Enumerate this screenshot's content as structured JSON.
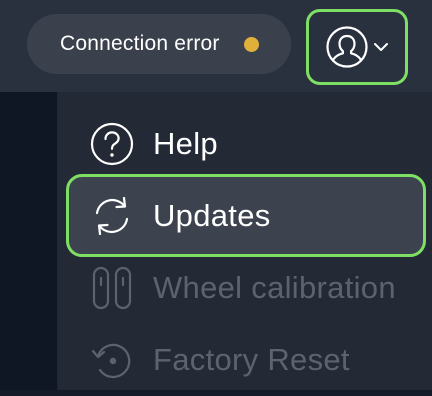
{
  "header": {
    "status": {
      "text": "Connection error",
      "dot_color": "#e0b13a"
    },
    "user_menu": {
      "icon": "user-icon",
      "chevron_icon": "chevron-down-icon",
      "focus_color": "#7de065"
    }
  },
  "menu": {
    "items": [
      {
        "label": "Help",
        "icon": "help-icon",
        "enabled": true
      },
      {
        "label": "Updates",
        "icon": "refresh-icon",
        "enabled": true,
        "focused": true
      },
      {
        "label": "Wheel calibration",
        "icon": "wheel-calibration-icon",
        "enabled": false
      },
      {
        "label": "Factory Reset",
        "icon": "factory-reset-icon",
        "enabled": false
      }
    ]
  },
  "colors": {
    "focus_outline": "#7de065",
    "enabled_text": "#ffffff",
    "disabled_text": "#5c636f",
    "menu_background": "#242a35",
    "header_background": "#2a313e"
  }
}
